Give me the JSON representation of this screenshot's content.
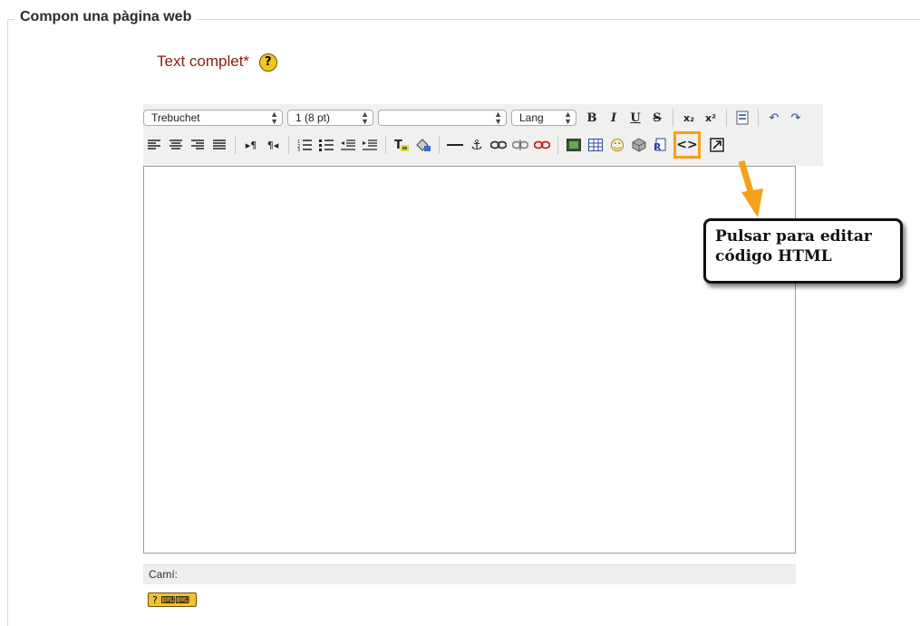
{
  "fieldset": {
    "legend": "Compon una pàgina web"
  },
  "field": {
    "label": "Text complet*",
    "help_icon": "?"
  },
  "toolbar": {
    "font_family": "Trebuchet",
    "font_size": "1 (8 pt)",
    "format": "",
    "lang": "Lang",
    "bold": "B",
    "italic": "I",
    "underline": "U",
    "strike": "S",
    "subscript": "x₂",
    "superscript": "x²",
    "html_source": "<>"
  },
  "editor": {
    "path_label": "Camí:"
  },
  "keyboard_help": "? ⌨⌨",
  "callout": {
    "line1": "Pulsar para editar",
    "line2": "código HTML"
  },
  "colors": {
    "accent": "#f4a11b",
    "label": "#8a1b0e"
  }
}
